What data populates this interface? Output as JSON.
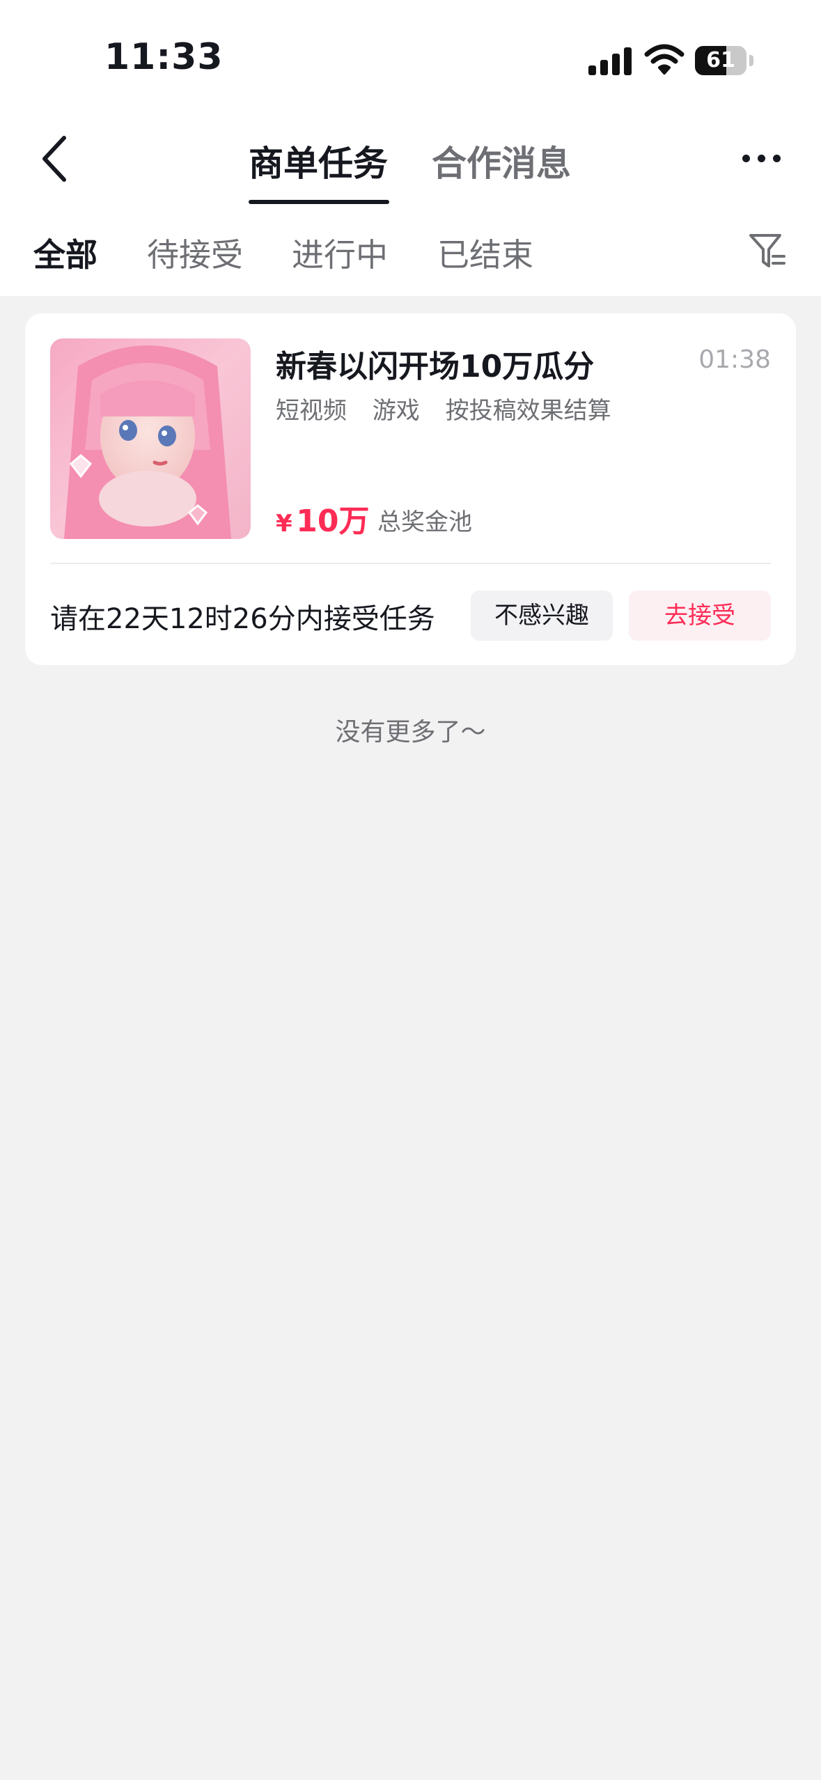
{
  "status_bar": {
    "time": "11:33",
    "battery": "61",
    "battery_level": 0.61
  },
  "header": {
    "back_icon": "chevron-left-icon",
    "tabs": [
      {
        "label": "商单任务",
        "active": true
      },
      {
        "label": "合作消息",
        "active": false
      }
    ],
    "more_icon": "more-horizontal-icon"
  },
  "filter_tabs": [
    {
      "label": "全部",
      "active": true
    },
    {
      "label": "待接受",
      "active": false
    },
    {
      "label": "进行中",
      "active": false
    },
    {
      "label": "已结束",
      "active": false
    }
  ],
  "filter_icon": "filter-icon",
  "tasks": [
    {
      "title": "新春以闪开场10万瓜分",
      "time": "01:38",
      "tags": [
        "短视频",
        "游戏",
        "按投稿效果结算"
      ],
      "currency": "¥",
      "amount": "10万",
      "amount_label": "总奖金池",
      "deadline": "请在22天12时26分内接受任务",
      "decline_label": "不感兴趣",
      "accept_label": "去接受"
    }
  ],
  "footer": {
    "no_more": "没有更多了～"
  },
  "colors": {
    "accent": "#fe2c55",
    "text_primary": "#16181f",
    "text_secondary": "#6e6f74",
    "background": "#f2f2f2"
  }
}
